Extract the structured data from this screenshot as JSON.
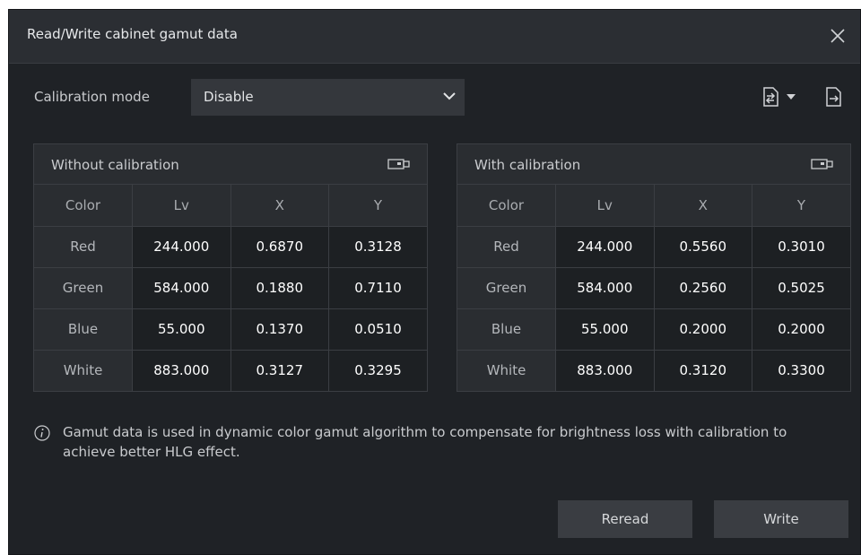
{
  "dialog": {
    "title": "Read/Write cabinet gamut data"
  },
  "mode": {
    "label": "Calibration mode",
    "value": "Disable"
  },
  "without": {
    "title": "Without calibration",
    "headers": [
      "Color",
      "Lv",
      "X",
      "Y"
    ],
    "rows": [
      {
        "color": "Red",
        "lv": "244.000",
        "x": "0.6870",
        "y": "0.3128"
      },
      {
        "color": "Green",
        "lv": "584.000",
        "x": "0.1880",
        "y": "0.7110"
      },
      {
        "color": "Blue",
        "lv": "55.000",
        "x": "0.1370",
        "y": "0.0510"
      },
      {
        "color": "White",
        "lv": "883.000",
        "x": "0.3127",
        "y": "0.3295"
      }
    ]
  },
  "with": {
    "title": "With calibration",
    "headers": [
      "Color",
      "Lv",
      "X",
      "Y"
    ],
    "rows": [
      {
        "color": "Red",
        "lv": "244.000",
        "x": "0.5560",
        "y": "0.3010"
      },
      {
        "color": "Green",
        "lv": "584.000",
        "x": "0.2560",
        "y": "0.5025"
      },
      {
        "color": "Blue",
        "lv": "55.000",
        "x": "0.2000",
        "y": "0.2000"
      },
      {
        "color": "White",
        "lv": "883.000",
        "x": "0.3120",
        "y": "0.3300"
      }
    ]
  },
  "info": {
    "text": "Gamut data is used in dynamic color gamut algorithm to compensate for brightness loss with calibration to achieve better HLG effect."
  },
  "buttons": {
    "reread": "Reread",
    "write": "Write"
  },
  "icons": {
    "close": "close-icon",
    "import": "import-file-icon",
    "dropdown": "caret-down-icon",
    "export": "export-file-icon",
    "panel": "usb-drive-icon",
    "info": "info-icon",
    "chevron": "chevron-down-icon"
  },
  "colors": {
    "background": "#1f2226",
    "panel": "#2a2d31",
    "value_cell": "#1d2023",
    "button": "#3a3d42",
    "titlebar": "#2b2e33"
  }
}
